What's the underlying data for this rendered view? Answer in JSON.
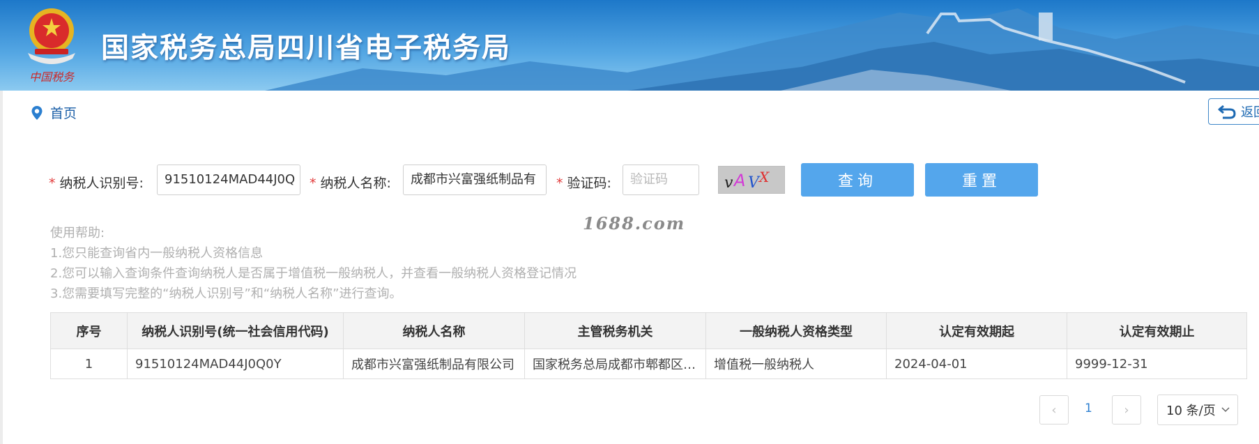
{
  "header": {
    "title": "国家税务总局四川省电子税务局",
    "emblem_caption": "中国税务"
  },
  "breadcrumb": {
    "home_label": "首页"
  },
  "back_button": {
    "label": "返回"
  },
  "form": {
    "taxpayer_id_label": "纳税人识别号:",
    "taxpayer_id_value": "91510124MAD44J0Q",
    "taxpayer_name_label": "纳税人名称:",
    "taxpayer_name_value": "成都市兴富强纸制品有",
    "captcha_label": "验证码:",
    "captcha_placeholder": "验证码",
    "captcha_image_text": "vAVX",
    "query_button": "查询",
    "reset_button": "重置",
    "required_mark": "*"
  },
  "watermark": "1688.com",
  "help": {
    "title": "使用帮助:",
    "lines": [
      "1.您只能查询省内一般纳税人资格信息",
      "2.您可以输入查询条件查询纳税人是否属于增值税一般纳税人，并查看一般纳税人资格登记情况",
      "3.您需要填写完整的“纳税人识别号”和“纳税人名称”进行查询。"
    ]
  },
  "table": {
    "headers": [
      "序号",
      "纳税人识别号(统一社会信用代码)",
      "纳税人名称",
      "主管税务机关",
      "一般纳税人资格类型",
      "认定有效期起",
      "认定有效期止"
    ],
    "rows": [
      [
        "1",
        "91510124MAD44J0Q0Y",
        "成都市兴富强纸制品有限公司",
        "国家税务总局成都市郫都区税务局",
        "增值税一般纳税人",
        "2024-04-01",
        "9999-12-31"
      ]
    ]
  },
  "pager": {
    "prev": "‹",
    "current_page": "1",
    "next": "›",
    "page_size": "10 条/页"
  },
  "colors": {
    "banner": "#2b8ad8",
    "button": "#54a6ec",
    "link": "#1b5fa7",
    "required": "#e23c3c"
  }
}
